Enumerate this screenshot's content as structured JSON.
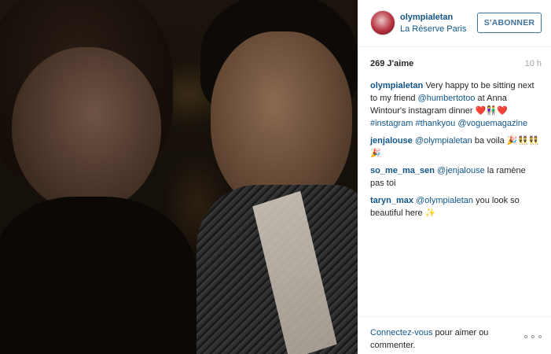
{
  "post": {
    "photo_alt": "Selfie of two people at a dinner",
    "header": {
      "username": "olympialetan",
      "location": "La Réserve Paris",
      "follow_label": "S'ABONNER"
    },
    "likes": "269 J'aime",
    "time_ago": "10 h",
    "caption": {
      "username": "olympialetan",
      "text_1": "Very happy to be sitting next to my friend ",
      "mention": "@humbertotoo",
      "text_2": " at Anna Wintour's instagram dinner ",
      "emoji": "❤️👫❤️",
      "tag_1": "#instagram",
      "tag_2": "#thankyou",
      "tag_3": "@voguemagazine"
    },
    "comments": [
      {
        "username": "jenjalouse",
        "mention": "@olympialetan",
        "text": " ba voila ",
        "emoji": "🎉👯👯🎉"
      },
      {
        "username": "so_me_ma_sen",
        "mention": "@jenjalouse",
        "text": " la ramène pas toi",
        "emoji": ""
      },
      {
        "username": "taryn_max",
        "mention": "@olympialetan",
        "text": " you look so beautiful here ",
        "emoji": "✨"
      }
    ],
    "footer": {
      "login_link": "Connectez-vous",
      "login_text": " pour aimer ou commenter.",
      "more_icon": "ellipsis-icon"
    }
  }
}
